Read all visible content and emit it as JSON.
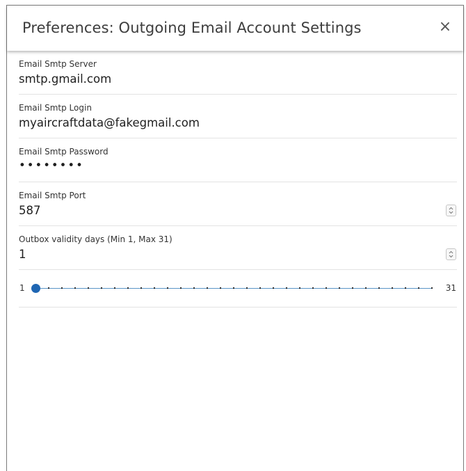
{
  "dialog": {
    "title": "Preferences: Outgoing Email Account Settings",
    "close_glyph": "×"
  },
  "fields": [
    {
      "label": "Email Smtp Server",
      "value": "smtp.gmail.com"
    },
    {
      "label": "Email Smtp Login",
      "value": "myaircraftdata@fakegmail.com"
    },
    {
      "label": "Email Smtp Password",
      "value": "••••••••"
    },
    {
      "label": "Email Smtp Port",
      "value": "587"
    },
    {
      "label": "Outbox validity days (Min 1, Max 31)",
      "value": "1"
    }
  ],
  "slider": {
    "min_label": "1",
    "max_label": "31",
    "min": 1,
    "max": 31,
    "value": 1
  },
  "colors": {
    "accent": "#1f66b3",
    "track": "#5a95c7"
  }
}
